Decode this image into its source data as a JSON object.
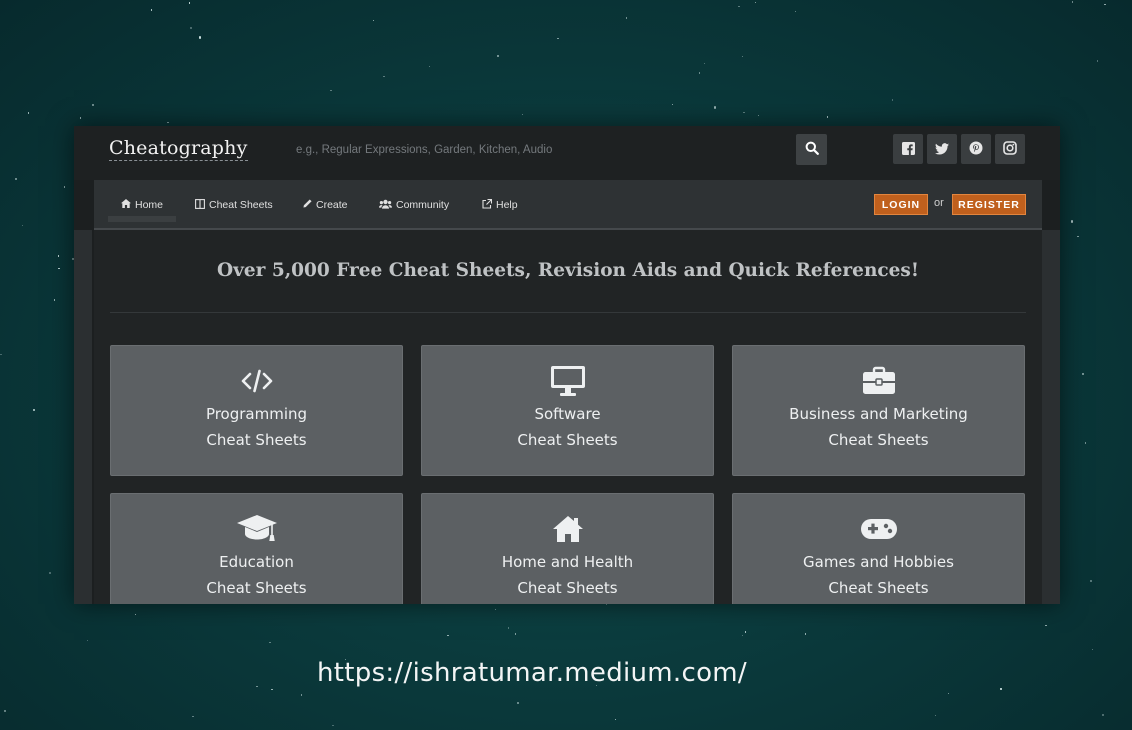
{
  "site": {
    "logo": "Cheatography",
    "search_placeholder": "e.g., Regular Expressions, Garden, Kitchen, Audio",
    "social_icons": [
      "facebook-icon",
      "twitter-icon",
      "pinterest-icon",
      "instagram-icon"
    ]
  },
  "nav": {
    "items": [
      {
        "label": "Home",
        "icon": "home-icon"
      },
      {
        "label": "Cheat Sheets",
        "icon": "columns-icon"
      },
      {
        "label": "Create",
        "icon": "pencil-icon"
      },
      {
        "label": "Community",
        "icon": "users-icon"
      },
      {
        "label": "Help",
        "icon": "external-link-icon"
      }
    ],
    "login": "LOGIN",
    "or": "or",
    "register": "REGISTER"
  },
  "main": {
    "headline": "Over 5,000 Free Cheat Sheets, Revision Aids and Quick References!",
    "categories": [
      {
        "name": "Programming",
        "subtitle": "Cheat Sheets",
        "icon": "code-icon"
      },
      {
        "name": "Software",
        "subtitle": "Cheat Sheets",
        "icon": "monitor-icon"
      },
      {
        "name": "Business and Marketing",
        "subtitle": "Cheat Sheets",
        "icon": "briefcase-icon"
      },
      {
        "name": "Education",
        "subtitle": "Cheat Sheets",
        "icon": "graduation-cap-icon"
      },
      {
        "name": "Home and Health",
        "subtitle": "Cheat Sheets",
        "icon": "house-icon"
      },
      {
        "name": "Games and Hobbies",
        "subtitle": "Cheat Sheets",
        "icon": "gamepad-icon"
      }
    ]
  },
  "footer": {
    "url": "https://ishratumar.medium.com/"
  },
  "colors": {
    "background": "#0b3b3d",
    "topbar": "#1e2122",
    "navbar": "#2e3234",
    "card": "#5c6063",
    "accent": "#c0601d"
  }
}
